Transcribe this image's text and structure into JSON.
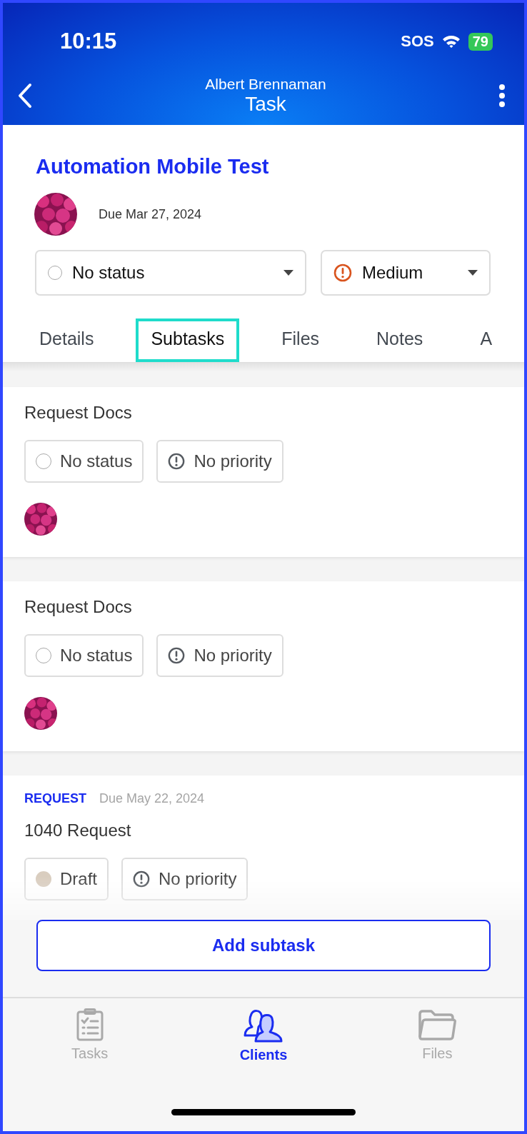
{
  "status_bar": {
    "time": "10:15",
    "carrier": "SOS",
    "battery": "79"
  },
  "nav": {
    "subtitle": "Albert Brennaman",
    "title": "Task"
  },
  "task": {
    "title": "Automation Mobile Test",
    "due": "Due Mar 27, 2024",
    "status": {
      "label": "No status",
      "kind": "none"
    },
    "priority": {
      "label": "Medium",
      "kind": "medium"
    }
  },
  "tabs": [
    {
      "label": "Details",
      "selected": false
    },
    {
      "label": "Subtasks",
      "selected": true
    },
    {
      "label": "Files",
      "selected": false
    },
    {
      "label": "Notes",
      "selected": false
    },
    {
      "label": "A",
      "selected": false
    }
  ],
  "subtasks": [
    {
      "name": "Request Docs",
      "status": {
        "label": "No status",
        "kind": "none"
      },
      "priority": {
        "label": "No priority",
        "kind": "none"
      }
    },
    {
      "name": "Request Docs",
      "status": {
        "label": "No status",
        "kind": "none"
      },
      "priority": {
        "label": "No priority",
        "kind": "none"
      }
    },
    {
      "tag": "REQUEST",
      "due": "Due May 22, 2024",
      "name": "1040 Request",
      "status": {
        "label": "Draft",
        "kind": "draft"
      },
      "priority": {
        "label": "No priority",
        "kind": "none"
      }
    }
  ],
  "add_button": "Add subtask",
  "bottom_nav": [
    {
      "label": "Tasks",
      "kind": "tasks",
      "selected": false
    },
    {
      "label": "Clients",
      "kind": "clients",
      "selected": true
    },
    {
      "label": "Files",
      "kind": "files",
      "selected": false
    }
  ]
}
